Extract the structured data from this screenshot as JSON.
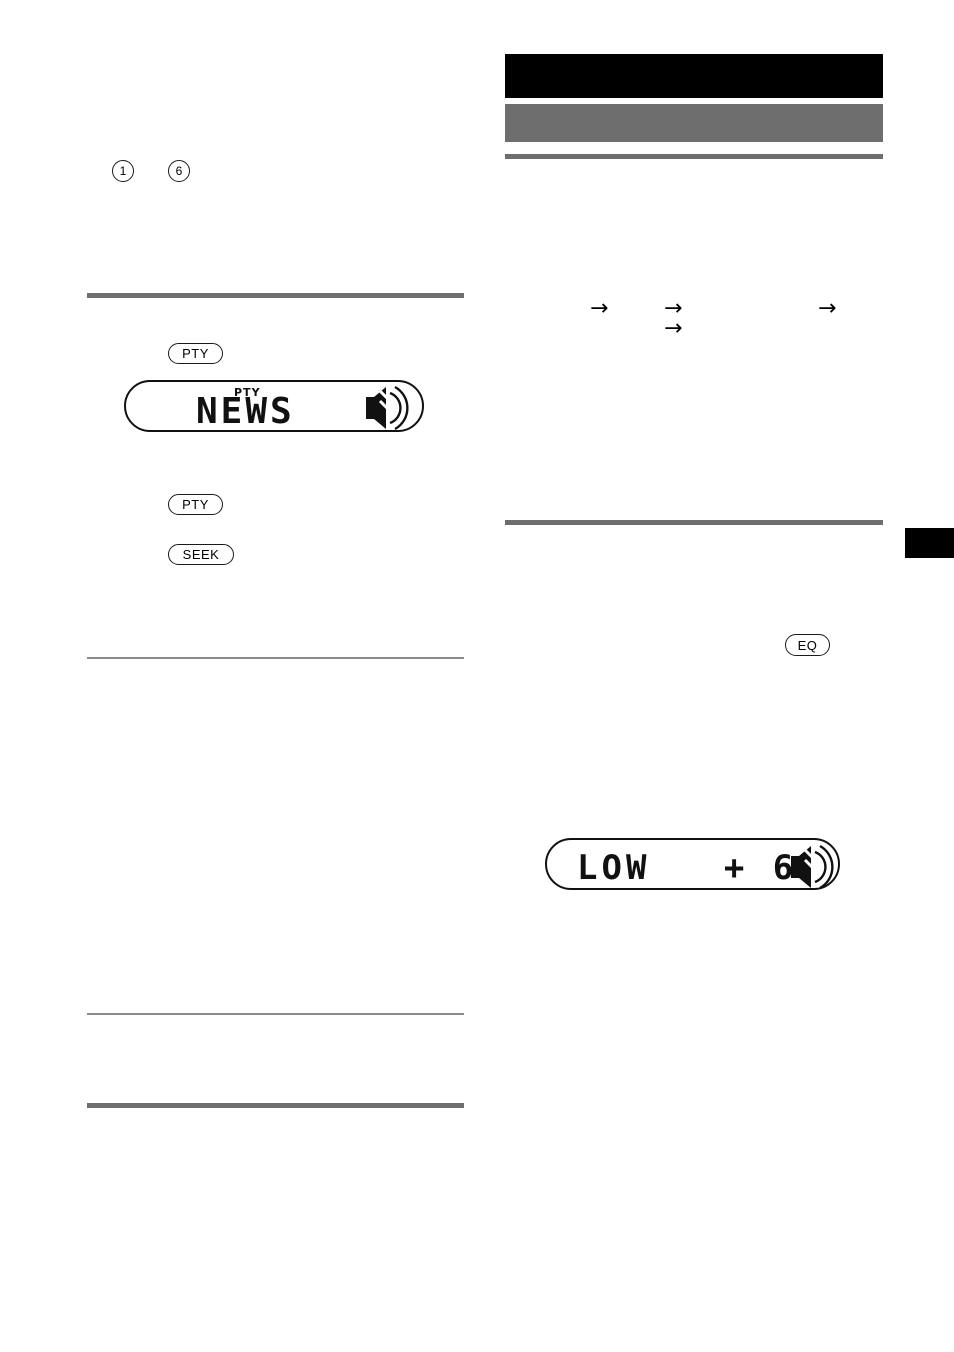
{
  "document": {
    "page_number": "",
    "language": "en"
  },
  "left_column": {
    "preset_buttons": [
      {
        "label": "1",
        "name": "preset-button-1"
      },
      {
        "label": "6",
        "name": "preset-button-6"
      }
    ],
    "buttons": [
      {
        "label": "PTY",
        "name": "pty-button-top"
      },
      {
        "label": "PTY",
        "name": "pty-button-middle"
      },
      {
        "label": "SEEK",
        "name": "seek-button"
      }
    ],
    "display": {
      "indicator": "PTY",
      "main_text": "NEWS",
      "name": "lcd-display-news"
    },
    "rules": [
      {
        "type": "thick",
        "name": "section-rule-1"
      },
      {
        "type": "thin",
        "name": "section-rule-2"
      },
      {
        "type": "thin",
        "name": "section-rule-3"
      },
      {
        "type": "thick",
        "name": "section-rule-4"
      }
    ]
  },
  "right_column": {
    "header_band": {
      "black_label": "",
      "gray_label": ""
    },
    "buttons": [
      {
        "label": "EQ",
        "name": "eq-button"
      }
    ],
    "arrows": [
      {
        "glyph": "→",
        "name": "flow-arrow-1"
      },
      {
        "glyph": "→",
        "name": "flow-arrow-2"
      },
      {
        "glyph": "→",
        "name": "flow-arrow-3"
      },
      {
        "glyph": "→",
        "name": "flow-arrow-4"
      }
    ],
    "display": {
      "main_text": "LOW   + 6",
      "name": "lcd-display-low"
    },
    "rules": [
      {
        "type": "thick",
        "name": "section-rule-5"
      },
      {
        "type": "thick",
        "name": "section-rule-6"
      }
    ]
  }
}
